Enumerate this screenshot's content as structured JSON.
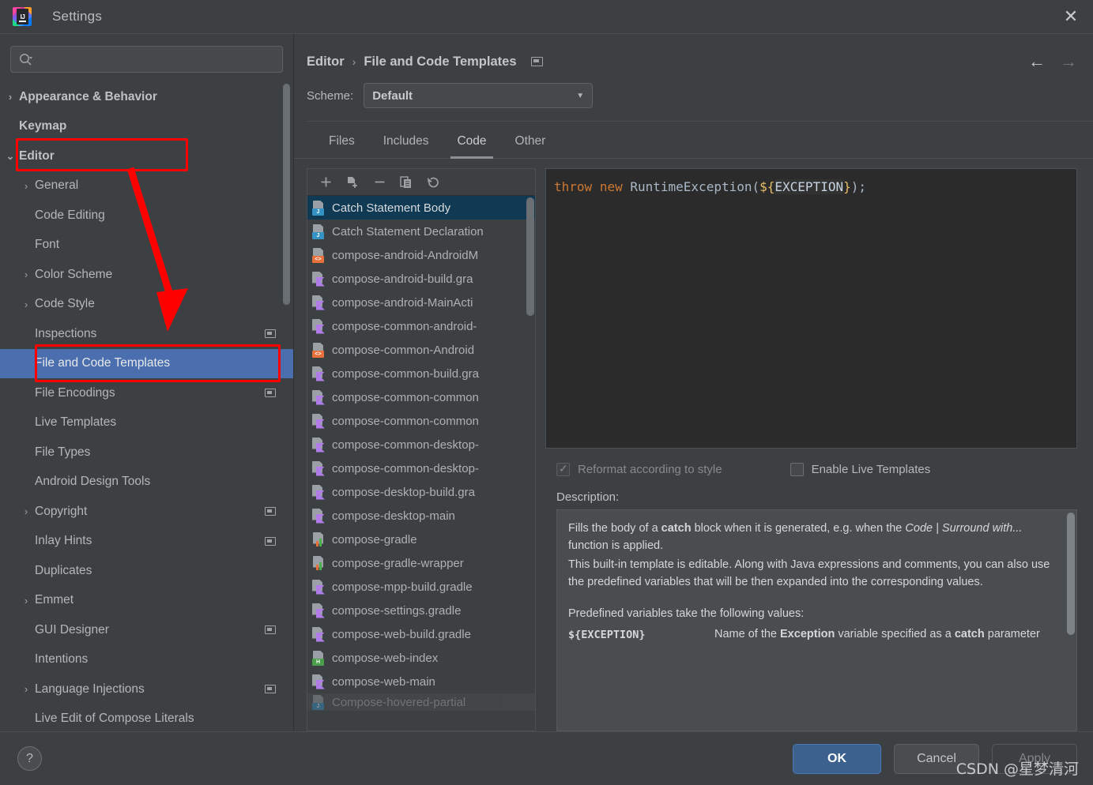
{
  "window": {
    "title": "Settings",
    "logo_icon": "intellij-idea-logo",
    "close_icon": "close-icon"
  },
  "sidebar": {
    "search": {
      "placeholder": "",
      "value": "",
      "icon": "search-icon"
    },
    "items": [
      {
        "label": "Appearance & Behavior",
        "depth": 0,
        "expandable": true,
        "expanded": false,
        "bold": true,
        "badge": false
      },
      {
        "label": "Keymap",
        "depth": 0,
        "expandable": false,
        "bold": true,
        "badge": false
      },
      {
        "label": "Editor",
        "depth": 0,
        "expandable": true,
        "expanded": true,
        "bold": true,
        "badge": false
      },
      {
        "label": "General",
        "depth": 1,
        "expandable": true,
        "expanded": false,
        "bold": false,
        "badge": false
      },
      {
        "label": "Code Editing",
        "depth": 1,
        "expandable": false,
        "bold": false,
        "badge": false
      },
      {
        "label": "Font",
        "depth": 1,
        "expandable": false,
        "bold": false,
        "badge": false
      },
      {
        "label": "Color Scheme",
        "depth": 1,
        "expandable": true,
        "expanded": false,
        "bold": false,
        "badge": false
      },
      {
        "label": "Code Style",
        "depth": 1,
        "expandable": true,
        "expanded": false,
        "bold": false,
        "badge": false
      },
      {
        "label": "Inspections",
        "depth": 1,
        "expandable": false,
        "bold": false,
        "badge": true
      },
      {
        "label": "File and Code Templates",
        "depth": 1,
        "expandable": false,
        "bold": false,
        "badge": false,
        "selected": true
      },
      {
        "label": "File Encodings",
        "depth": 1,
        "expandable": false,
        "bold": false,
        "badge": true
      },
      {
        "label": "Live Templates",
        "depth": 1,
        "expandable": false,
        "bold": false,
        "badge": false
      },
      {
        "label": "File Types",
        "depth": 1,
        "expandable": false,
        "bold": false,
        "badge": false
      },
      {
        "label": "Android Design Tools",
        "depth": 1,
        "expandable": false,
        "bold": false,
        "badge": false
      },
      {
        "label": "Copyright",
        "depth": 1,
        "expandable": true,
        "expanded": false,
        "bold": false,
        "badge": true
      },
      {
        "label": "Inlay Hints",
        "depth": 1,
        "expandable": false,
        "bold": false,
        "badge": true
      },
      {
        "label": "Duplicates",
        "depth": 1,
        "expandable": false,
        "bold": false,
        "badge": false
      },
      {
        "label": "Emmet",
        "depth": 1,
        "expandable": true,
        "expanded": false,
        "bold": false,
        "badge": false
      },
      {
        "label": "GUI Designer",
        "depth": 1,
        "expandable": false,
        "bold": false,
        "badge": true
      },
      {
        "label": "Intentions",
        "depth": 1,
        "expandable": false,
        "bold": false,
        "badge": false
      },
      {
        "label": "Language Injections",
        "depth": 1,
        "expandable": true,
        "expanded": false,
        "bold": false,
        "badge": true
      },
      {
        "label": "Live Edit of Compose Literals",
        "depth": 1,
        "expandable": false,
        "bold": false,
        "badge": false
      }
    ]
  },
  "header": {
    "breadcrumb_root": "Editor",
    "breadcrumb_separator": "›",
    "breadcrumb_current": "File and Code Templates",
    "project_badge_icon": "project-scope-icon",
    "back_icon": "arrow-left-icon",
    "forward_icon": "arrow-right-icon",
    "scheme_label": "Scheme:",
    "scheme_value": "Default",
    "scheme_caret_icon": "chevron-down-icon"
  },
  "tabs": [
    {
      "label": "Files",
      "active": false
    },
    {
      "label": "Includes",
      "active": false
    },
    {
      "label": "Code",
      "active": true
    },
    {
      "label": "Other",
      "active": false
    }
  ],
  "list_toolbar": [
    {
      "icon": "add-icon",
      "glyph": "+"
    },
    {
      "icon": "copy-template-icon",
      "glyph": ""
    },
    {
      "icon": "remove-icon",
      "glyph": "−"
    },
    {
      "icon": "duplicate-icon",
      "glyph": ""
    },
    {
      "icon": "reset-icon",
      "glyph": "↺"
    }
  ],
  "templates": [
    {
      "label": "Catch Statement Body",
      "type": "java",
      "selected": true
    },
    {
      "label": "Catch Statement Declaration",
      "type": "java"
    },
    {
      "label": "compose-android-AndroidM",
      "type": "xml"
    },
    {
      "label": "compose-android-build.gra",
      "type": "kt"
    },
    {
      "label": "compose-android-MainActi",
      "type": "kt"
    },
    {
      "label": "compose-common-android-",
      "type": "kt"
    },
    {
      "label": "compose-common-Android",
      "type": "xml"
    },
    {
      "label": "compose-common-build.gra",
      "type": "kt"
    },
    {
      "label": "compose-common-common",
      "type": "kt"
    },
    {
      "label": "compose-common-common",
      "type": "kt"
    },
    {
      "label": "compose-common-desktop-",
      "type": "kt"
    },
    {
      "label": "compose-common-desktop-",
      "type": "kt"
    },
    {
      "label": "compose-desktop-build.gra",
      "type": "kt"
    },
    {
      "label": "compose-desktop-main",
      "type": "kt"
    },
    {
      "label": "compose-gradle",
      "type": "gradle"
    },
    {
      "label": "compose-gradle-wrapper",
      "type": "gradle"
    },
    {
      "label": "compose-mpp-build.gradle",
      "type": "kt"
    },
    {
      "label": "compose-settings.gradle",
      "type": "kt"
    },
    {
      "label": "compose-web-build.gradle",
      "type": "kt"
    },
    {
      "label": "compose-web-index",
      "type": "html"
    },
    {
      "label": "compose-web-main",
      "type": "kt"
    },
    {
      "label": "Compose-hovered-partial",
      "type": "java",
      "hover": true
    }
  ],
  "code_editor": {
    "tokens": [
      {
        "text": "throw",
        "kind": "kw"
      },
      {
        "text": " ",
        "kind": "punct"
      },
      {
        "text": "new",
        "kind": "kw"
      },
      {
        "text": " ",
        "kind": "punct"
      },
      {
        "text": "RuntimeException",
        "kind": "cls"
      },
      {
        "text": "(",
        "kind": "punct"
      },
      {
        "text": "${",
        "kind": "brace"
      },
      {
        "text": "EXCEPTION",
        "kind": "var"
      },
      {
        "text": "}",
        "kind": "brace"
      },
      {
        "text": ");",
        "kind": "punct"
      }
    ],
    "plain": "throw new RuntimeException(${EXCEPTION});"
  },
  "options": {
    "reformat": {
      "label": "Reformat according to style",
      "checked": true,
      "disabled": true
    },
    "live_templates": {
      "label": "Enable Live Templates",
      "checked": false,
      "disabled": false
    }
  },
  "description": {
    "label": "Description:",
    "para1_before": "Fills the body of a ",
    "para1_bold": "catch",
    "para1_mid": " block when it is generated, e.g. when the ",
    "para1_italic": "Code | Surround with...",
    "para1_after": " function is applied.",
    "para2": "This built-in template is editable. Along with Java expressions and comments, you can also use the predefined variables that will be then expanded into the corresponding values.",
    "para3": "Predefined variables take the following values:",
    "var_name": "${EXCEPTION}",
    "var_desc_before": "Name of the ",
    "var_desc_bold1": "Exception",
    "var_desc_mid": " variable specified as a ",
    "var_desc_bold2": "catch",
    "var_desc_after": " parameter"
  },
  "footer": {
    "help_label": "?",
    "ok_label": "OK",
    "cancel_label": "Cancel",
    "apply_label": "Apply"
  },
  "watermark": "CSDN @星梦清河",
  "colors": {
    "accent_selection": "#4b6eaf",
    "list_selection": "#103954",
    "annotation_red": "#ff0000",
    "primary_button": "#3c618f",
    "keyword": "#cc7832",
    "class_name": "#a9b7c6",
    "brace": "#e8bf6a"
  }
}
